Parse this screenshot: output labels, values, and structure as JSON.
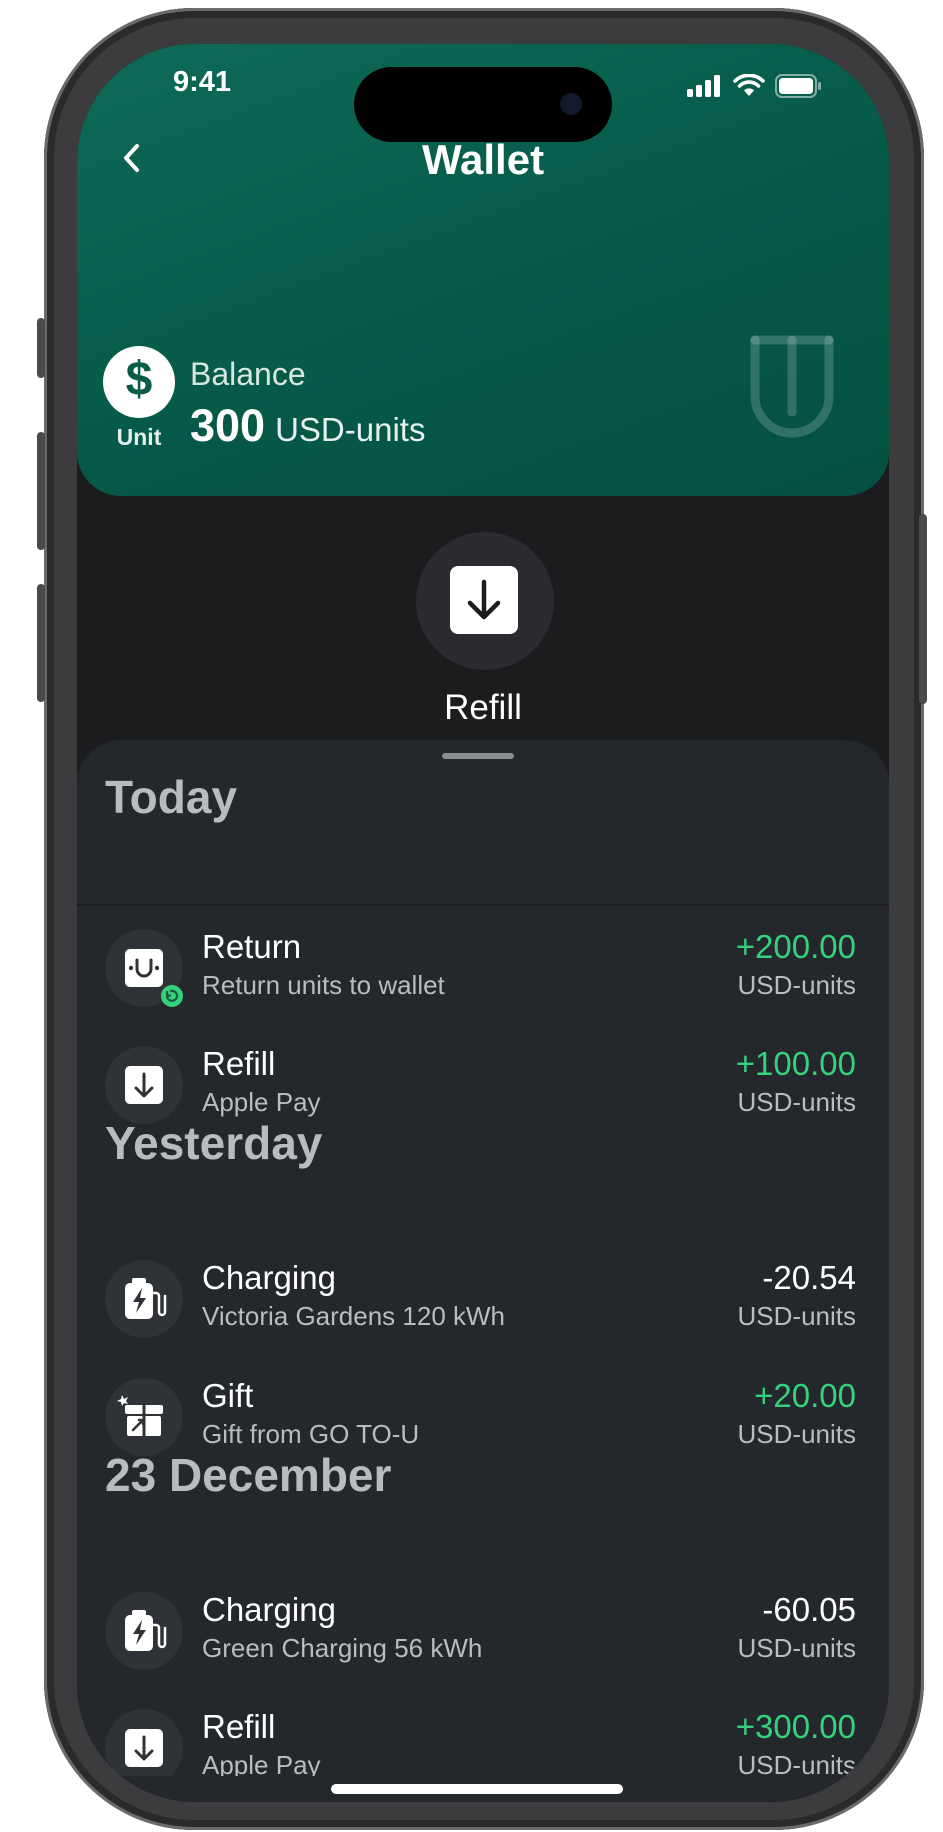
{
  "status": {
    "time": "9:41"
  },
  "nav": {
    "title": "Wallet"
  },
  "balance": {
    "coin_symbol": "$",
    "coin_label": "Unit",
    "label": "Balance",
    "amount": "300",
    "unit": "USD-units"
  },
  "action": {
    "refill_label": "Refill"
  },
  "sections": [
    {
      "heading": "Today",
      "items": [
        {
          "title": "Return",
          "subtitle": "Return units to wallet",
          "amount": "+200.00",
          "unit": "USD-units",
          "icon": "return-icon"
        },
        {
          "title": "Refill",
          "subtitle": "Apple Pay",
          "amount": "+100.00",
          "unit": "USD-units",
          "icon": "refill-icon"
        }
      ]
    },
    {
      "heading": "Yesterday",
      "items": [
        {
          "title": "Charging",
          "subtitle": "Victoria Gardens 120 kWh",
          "amount": "-20.54",
          "unit": "USD-units",
          "icon": "charging-icon"
        },
        {
          "title": "Gift",
          "subtitle": "Gift from GO TO-U",
          "amount": "+20.00",
          "unit": "USD-units",
          "icon": "gift-icon"
        }
      ]
    },
    {
      "heading": "23 December",
      "items": [
        {
          "title": "Charging",
          "subtitle": "Green Charging 56 kWh",
          "amount": "-60.05",
          "unit": "USD-units",
          "icon": "charging-icon"
        },
        {
          "title": "Refill",
          "subtitle": "Apple Pay",
          "amount": "+300.00",
          "unit": "USD-units",
          "icon": "refill-icon"
        }
      ]
    }
  ],
  "colors": {
    "accent_green": "#34d27a",
    "header_green": "#075c4a",
    "background": "#1b1c1e",
    "sheet": "#24272b"
  }
}
